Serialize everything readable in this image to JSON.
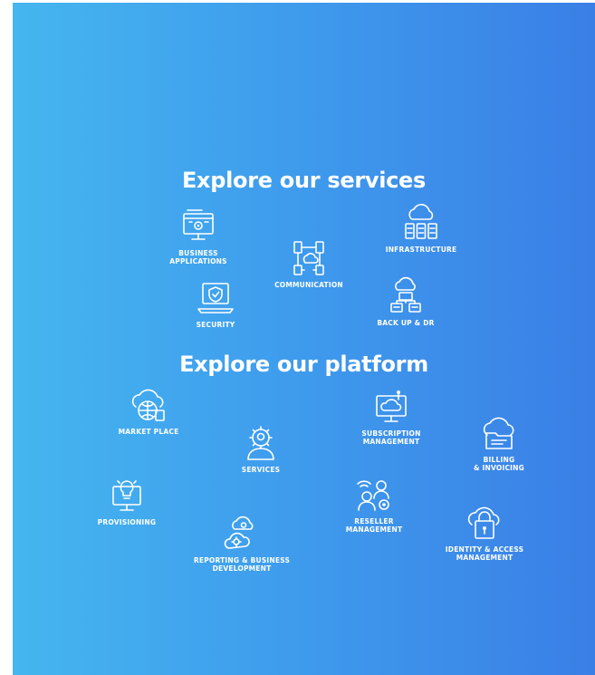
{
  "services": {
    "heading": "Explore our services",
    "items": [
      {
        "label": "BUSINESS\nAPPLICATIONS",
        "icon": "business-applications-icon"
      },
      {
        "label": "INFRASTRUCTURE",
        "icon": "cloud-server-icon"
      },
      {
        "label": "COMMUNICATION",
        "icon": "network-communication-icon"
      },
      {
        "label": "SECURITY",
        "icon": "laptop-shield-icon"
      },
      {
        "label": "BACK UP & DR",
        "icon": "backup-database-icon"
      }
    ]
  },
  "platform": {
    "heading": "Explore our platform",
    "items": [
      {
        "label": "MARKET PLACE",
        "icon": "cloud-globe-icon"
      },
      {
        "label": "SUBSCRIPTION\nMANAGEMENT",
        "icon": "cloud-monitor-icon"
      },
      {
        "label": "BILLING\n& INVOICING",
        "icon": "cloud-folder-icon"
      },
      {
        "label": "SERVICES",
        "icon": "gear-user-icon"
      },
      {
        "label": "PROVISIONING",
        "icon": "lightbulb-monitor-icon"
      },
      {
        "label": "RESELLER\nMANAGEMENT",
        "icon": "reseller-users-icon"
      },
      {
        "label": "REPORTING & BUSINESS\nDEVELOPMENT",
        "icon": "cloud-gears-icon"
      },
      {
        "label": "IDENTITY & ACCESS\nMANAGEMENT",
        "icon": "cloud-lock-icon"
      }
    ]
  },
  "colors": {
    "gradient_start": "#45b6ef",
    "gradient_end": "#3a7fe6",
    "text": "#ffffff"
  }
}
